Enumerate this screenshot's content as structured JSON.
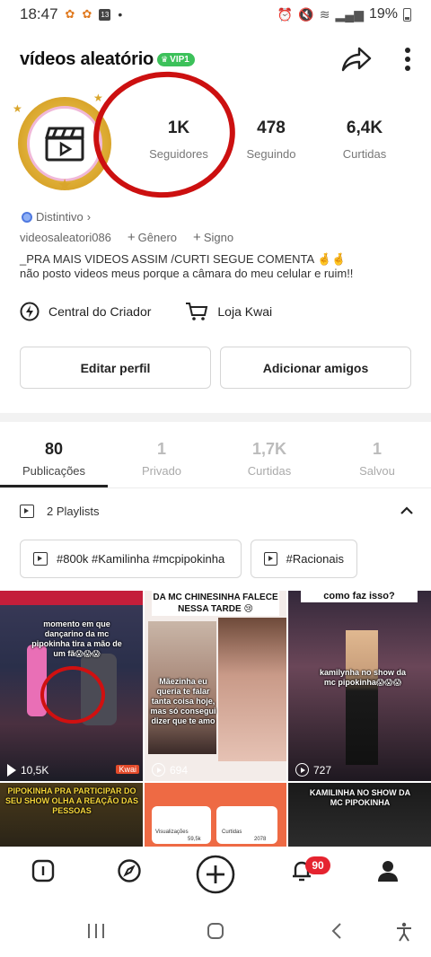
{
  "status_bar": {
    "time": "18:47",
    "battery": "19%"
  },
  "profile": {
    "username": "vídeos aleatório",
    "vip_label": "VIP1",
    "handle": "videosaleatori086",
    "badge_label": "Distintivo",
    "gender_label": "Gênero",
    "sign_label": "Signo",
    "bio_line1": "_PRA MAIS VIDEOS ASSIM /CURTI SEGUE COMENTA 🤞🤞",
    "bio_line2": "não posto videos meus porque  a câmara do meu celular e ruim!!"
  },
  "stats": [
    {
      "value": "1K",
      "label": "Seguidores"
    },
    {
      "value": "478",
      "label": "Seguindo"
    },
    {
      "value": "6,4K",
      "label": "Curtidas"
    }
  ],
  "links": {
    "creator_center": "Central do Criador",
    "kwai_shop": "Loja Kwai"
  },
  "buttons": {
    "edit_profile": "Editar perfil",
    "add_friends": "Adicionar amigos"
  },
  "tabs": [
    {
      "count": "80",
      "label": "Publicações"
    },
    {
      "count": "1",
      "label": "Privado"
    },
    {
      "count": "1,7K",
      "label": "Curtidas"
    },
    {
      "count": "1",
      "label": "Salvou"
    }
  ],
  "playlists": {
    "header": "2 Playlists",
    "items": [
      "#800k #Kamilinha #mcpipokinha",
      "#Racionais"
    ]
  },
  "videos": [
    {
      "caption": "momento em que dançarino da mc pipokinha tira a mão de um fã😱😱😱",
      "views": "10,5K",
      "tag": "Kwai"
    },
    {
      "caption": "DA MC CHINESINHA FALECE NESSA TARDE 😢",
      "subcaption": "Mãezinha eu queria te falar tanta coisa hoje, mas só consegui dizer que te amo",
      "views": "694"
    },
    {
      "caption": "como faz isso?",
      "subcaption": "kamilynha no show da mc pipokinha😱😱😱",
      "views": "727"
    },
    {
      "caption": "PIPOKINHA PRA PARTICIPAR DO SEU SHOW OLHA A REAÇÃO DAS PESSOAS"
    },
    {
      "caption": "Visualizações",
      "subcaption": "Curtidas",
      "views_a": "59,5k",
      "views_b": "2078"
    },
    {
      "caption": "KAMILINHA NO SHOW DA MC PIPOKINHA"
    }
  ],
  "bottom_nav": {
    "notification_count": "90"
  },
  "colors": {
    "vip_green": "#3cc15a",
    "badge_red": "#e5232f",
    "annotation_red": "#cc1010"
  }
}
